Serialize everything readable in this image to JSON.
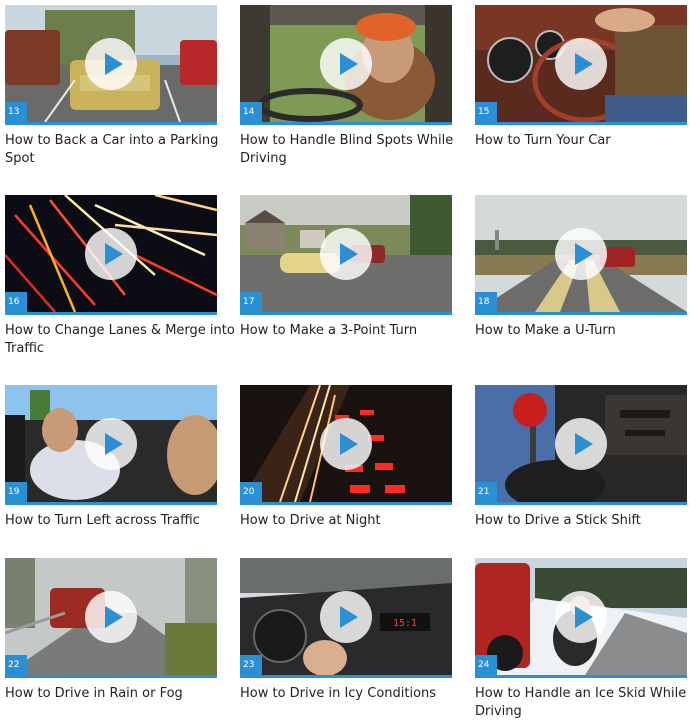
{
  "colors": {
    "accent": "#2b8fd4",
    "text": "#222222",
    "background": "#ffffff"
  },
  "play_icon": "play-icon",
  "videos": [
    {
      "number": "13",
      "title": "How to Back a Car into a Parking Spot"
    },
    {
      "number": "14",
      "title": "How to Handle Blind Spots While Driving"
    },
    {
      "number": "15",
      "title": "How to Turn Your Car"
    },
    {
      "number": "16",
      "title": "How to Change Lanes & Merge into Traffic"
    },
    {
      "number": "17",
      "title": "How to Make a 3-Point Turn"
    },
    {
      "number": "18",
      "title": "How to Make a U-Turn"
    },
    {
      "number": "19",
      "title": "How to Turn Left across Traffic"
    },
    {
      "number": "20",
      "title": "How to Drive at Night"
    },
    {
      "number": "21",
      "title": "How to Drive a Stick Shift"
    },
    {
      "number": "22",
      "title": "How to Drive in Rain or Fog"
    },
    {
      "number": "23",
      "title": "How to Drive in Icy Conditions"
    },
    {
      "number": "24",
      "title": "How to Handle an Ice Skid While Driving"
    }
  ]
}
